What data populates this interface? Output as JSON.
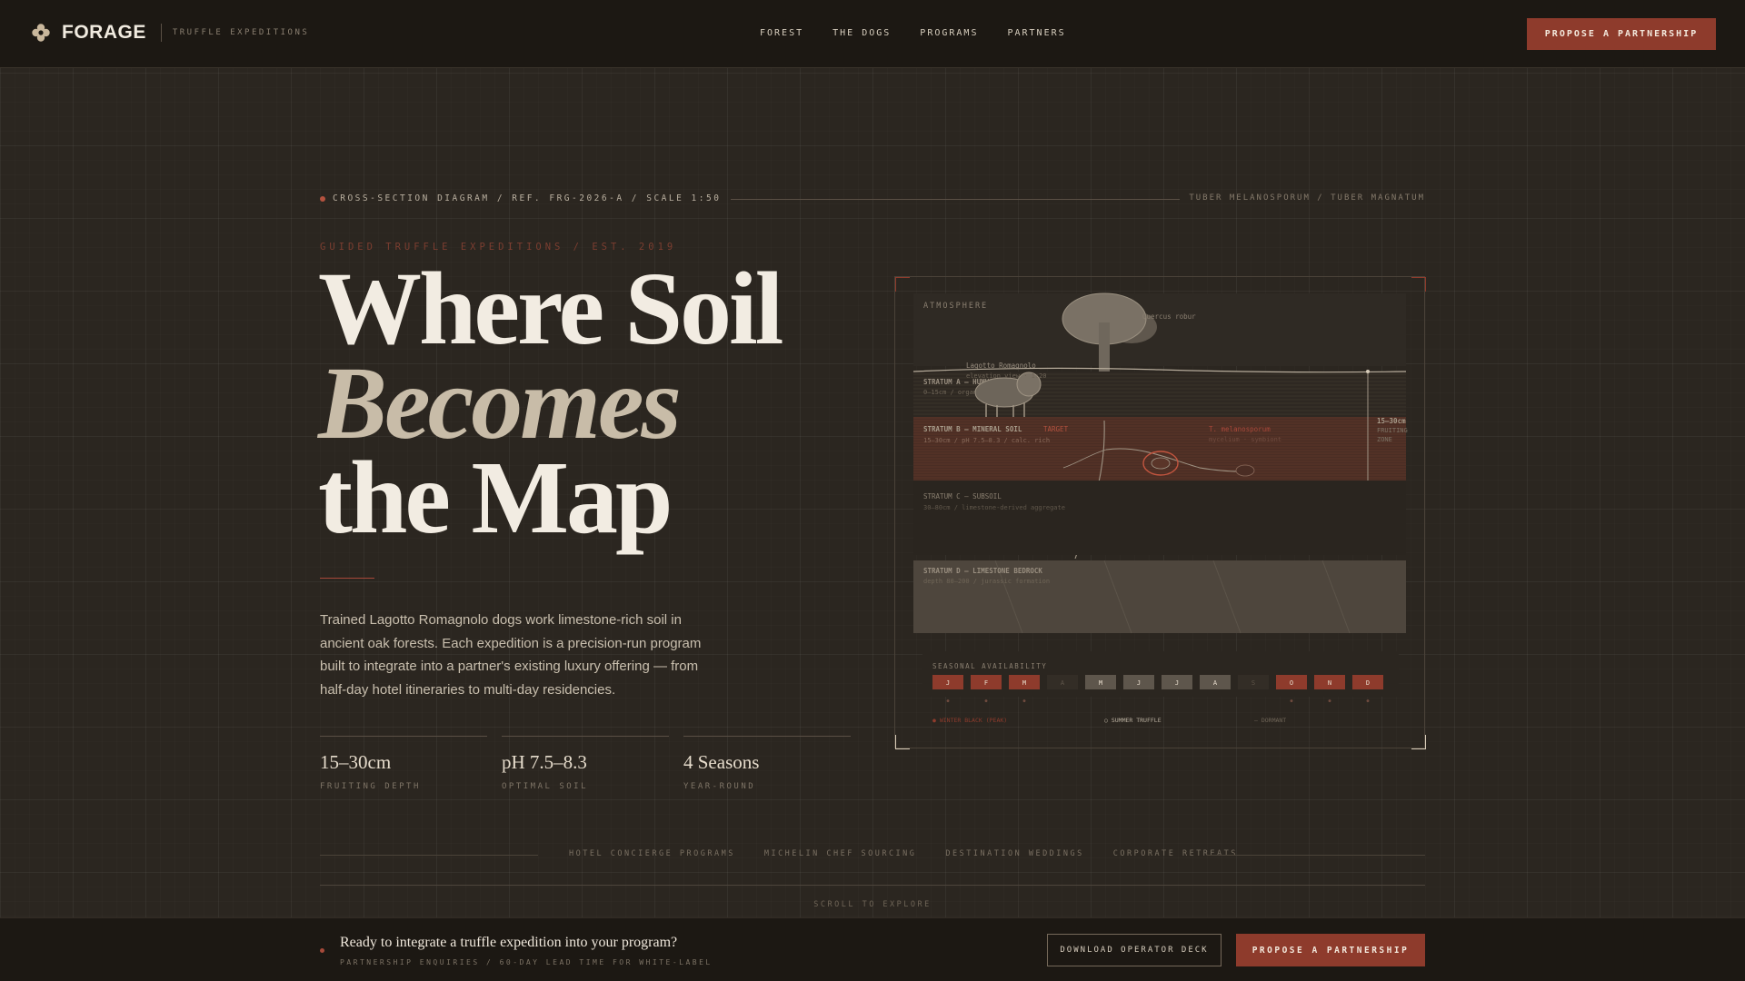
{
  "nav": {
    "brand_name": "FORAGE",
    "brand_tagline": "TRUFFLE EXPEDITIONS",
    "links": [
      "FOREST",
      "THE DOGS",
      "PROGRAMS",
      "PARTNERS"
    ],
    "cta_label": "PROPOSE A PARTNERSHIP"
  },
  "hero": {
    "ref_left": "CROSS-SECTION DIAGRAM / REF. FRG-2026-A / SCALE 1:50",
    "ref_right": "TUBER MELANOSPORUM / TUBER MAGNATUM",
    "eyebrow": "GUIDED TRUFFLE EXPEDITIONS / EST. 2019",
    "headline": [
      "Where Soil",
      "Becomes",
      "the Map"
    ],
    "body": "Trained Lagotto Romagnolo dogs work limestone-rich soil in ancient oak forests. Each expedition is a precision-run program built to integrate into a partner's existing luxury offering — from half-day hotel itineraries to multi-day residencies.",
    "stats": [
      {
        "value": "15–30cm",
        "label": "FRUITING DEPTH"
      },
      {
        "value": "pH 7.5–8.3",
        "label": "OPTIMAL SOIL"
      },
      {
        "value": "4 Seasons",
        "label": "YEAR-ROUND"
      }
    ]
  },
  "diagram": {
    "atmosphere_label": "ATMOSPHERE",
    "tree_label": "Quercus robur",
    "dog_label_1": "Lagotto Romagnolo",
    "dog_label_2": "elevation view · 1:20",
    "stratum_a_title": "STRATUM A — HUMUS LAYER",
    "stratum_a_sub": "0–15cm / organic matter 5%",
    "stratum_b_title": "STRATUM B — MINERAL SOIL",
    "stratum_b_tag": "TARGET",
    "stratum_b_sub": "15–30cm / pH 7.5–8.3 / calc. rich",
    "truffle_label_1": "T. melanosporum",
    "truffle_label_2": "mycelium · symbiont",
    "zone_label_1": "15–30cm",
    "zone_label_2": "FRUITING",
    "zone_label_3": "ZONE",
    "stratum_c_title": "STRATUM C — SUBSOIL",
    "stratum_c_sub": "30–80cm / limestone-derived aggregate",
    "stratum_d_title": "STRATUM D — LIMESTONE BEDROCK",
    "stratum_d_sub": "depth 80–200 / jurassic formation",
    "seasonal_title": "SEASONAL AVAILABILITY",
    "months": [
      "J",
      "F",
      "M",
      "A",
      "M",
      "J",
      "J",
      "A",
      "S",
      "O",
      "N",
      "D"
    ],
    "month_states": [
      "winter",
      "winter",
      "winter",
      "off",
      "summer",
      "summer",
      "summer",
      "summer",
      "off",
      "winter",
      "winter",
      "winter"
    ],
    "marker_label": "●",
    "legend_1": "● WINTER BLACK (PEAK)",
    "legend_2": "○ SUMMER TRUFFLE",
    "legend_3": "— DORMANT",
    "colors": {
      "winter": "#8e3b2c",
      "summer": "#5e564c",
      "off": "#332d26",
      "accent": "#b4523f"
    }
  },
  "clients": [
    "HOTEL CONCIERGE PROGRAMS",
    "MICHELIN CHEF SOURCING",
    "DESTINATION WEDDINGS",
    "CORPORATE RETREATS"
  ],
  "scroll_hint": "SCROLL TO EXPLORE",
  "bottom_bar": {
    "title": "Ready to integrate a truffle expedition into your program?",
    "subtitle": "PARTNERSHIP ENQUIRIES / 60-DAY LEAD TIME FOR WHITE-LABEL",
    "secondary_cta": "DOWNLOAD OPERATOR DECK",
    "primary_cta": "PROPOSE A PARTNERSHIP"
  }
}
